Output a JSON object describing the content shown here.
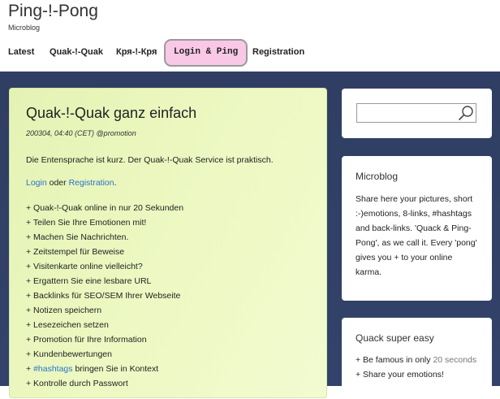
{
  "site": {
    "title": "Ping-!-Pong",
    "tagline": "Microblog"
  },
  "nav": {
    "latest": "Latest",
    "quak": "Quak-!-Quak",
    "krya": "Кря-!-Кря",
    "login": "Login & Ping",
    "registration": "Registration"
  },
  "article": {
    "title": "Quak-!-Quak ganz einfach",
    "meta": "200304, 04:40 (CET) @promotion",
    "intro": "Die Entensprache ist kurz. Der Quak-!-Quak Service ist praktisch.",
    "login_link": "Login",
    "or_text": " oder ",
    "registration_link": "Registration",
    "period": ".",
    "features": [
      "+ Quak-!-Quak online in nur 20 Sekunden",
      "+ Teilen Sie Ihre Emotionen mit!",
      "+ Machen Sie Nachrichten.",
      "+ Zeitstempel für Beweise",
      "+ Visitenkarte online vielleicht?",
      "+ Ergattern Sie eine lesbare URL",
      "+ Backlinks für SEO/SEM Ihrer Webseite",
      "+ Notizen speichern",
      "+ Lesezeichen setzen",
      "+ Promotion für Ihre Information",
      "+ Kundenbewertungen"
    ],
    "hashtag_prefix": "+ ",
    "hashtag_link": "#hashtags",
    "hashtag_suffix": " bringen Sie in Kontext",
    "last_feature": "+ Kontrolle durch Passwort"
  },
  "search": {
    "placeholder": ""
  },
  "microblog": {
    "title": "Microblog",
    "text": "Share here your pictures, short :-)emotions, 8-links, #hashtags and back-links. 'Quack & Ping-Pong', as we call it. Every 'pong' gives you + to your online karma."
  },
  "quack": {
    "title": "Quack super easy",
    "item1_prefix": "+ Be famous in only ",
    "item1_highlight": "20 seconds",
    "item2": "+ Share your emotions!"
  },
  "colors": {
    "accent_link": "#2a74c9",
    "login_bg": "#f9c8e6",
    "panel_bg": "#e9f6bd",
    "page_bg": "#2f3e62"
  }
}
